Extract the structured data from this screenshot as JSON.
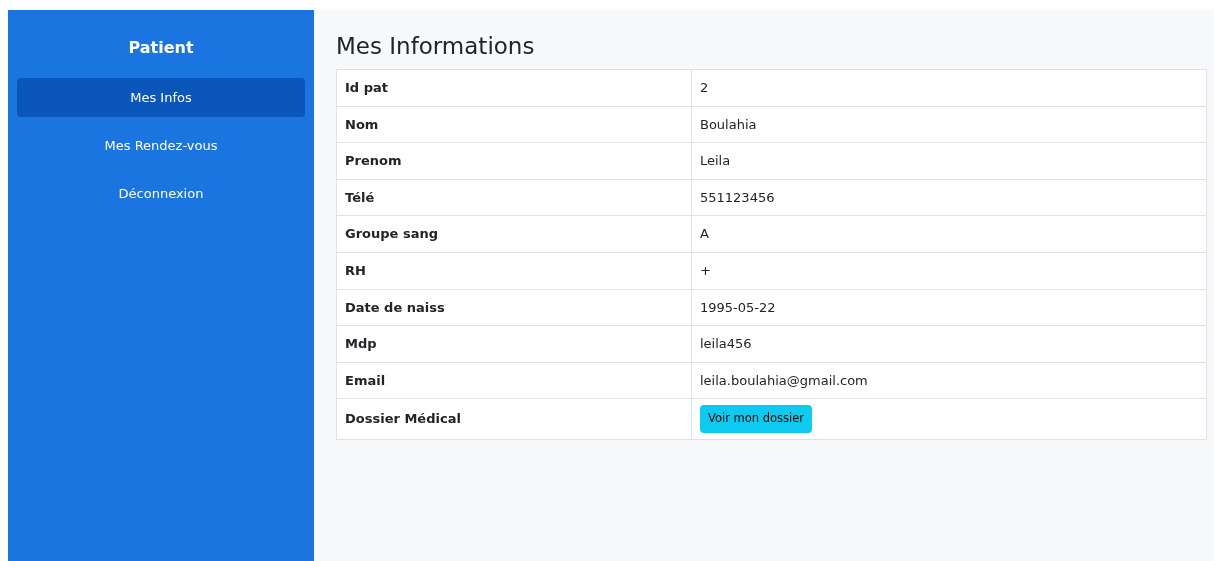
{
  "sidebar": {
    "title": "Patient",
    "items": [
      {
        "label": "Mes Infos",
        "selected": true
      },
      {
        "label": "Mes Rendez-vous",
        "selected": false
      },
      {
        "label": "Déconnexion",
        "selected": false
      }
    ]
  },
  "main": {
    "title": "Mes Informations",
    "rows": [
      {
        "label": "Id pat",
        "value": "2"
      },
      {
        "label": "Nom",
        "value": "Boulahia"
      },
      {
        "label": "Prenom",
        "value": "Leila"
      },
      {
        "label": "Télé",
        "value": "551123456"
      },
      {
        "label": "Groupe sang",
        "value": "A"
      },
      {
        "label": "RH",
        "value": "+"
      },
      {
        "label": "Date de naiss",
        "value": "1995-05-22"
      },
      {
        "label": "Mdp",
        "value": "leila456"
      },
      {
        "label": "Email",
        "value": "leila.boulahia@gmail.com"
      },
      {
        "label": "Dossier Médical",
        "kind": "button",
        "value": "Voir mon dossier"
      }
    ]
  }
}
